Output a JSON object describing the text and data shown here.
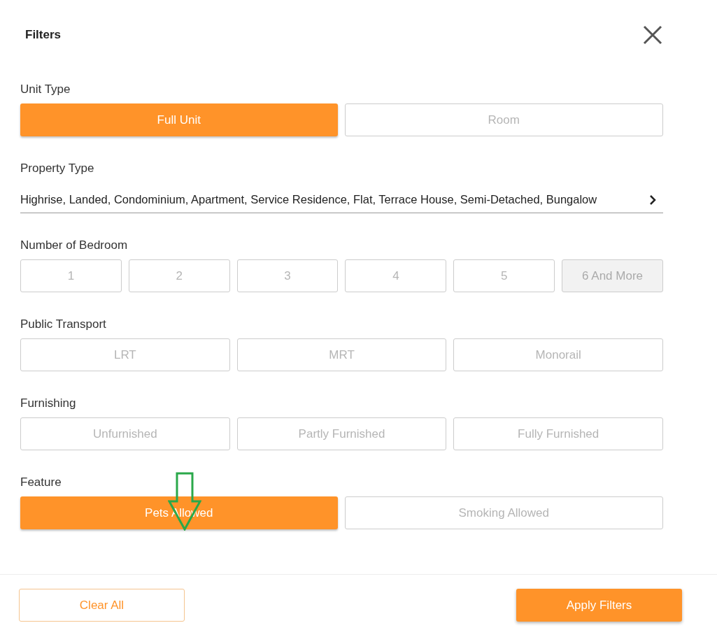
{
  "title": "Filters",
  "sections": [
    {
      "kind": "options",
      "label": "Unit Type",
      "options": [
        {
          "label": "Full Unit",
          "selected": true,
          "disabled": false
        },
        {
          "label": "Room",
          "selected": false,
          "disabled": false
        }
      ]
    },
    {
      "kind": "select",
      "label": "Property Type",
      "value": "Highrise, Landed, Condominium, Apartment, Service Residence, Flat, Terrace House, Semi-Detached, Bungalow"
    },
    {
      "kind": "options",
      "label": "Number of Bedroom",
      "options": [
        {
          "label": "1",
          "selected": false,
          "disabled": false
        },
        {
          "label": "2",
          "selected": false,
          "disabled": false
        },
        {
          "label": "3",
          "selected": false,
          "disabled": false
        },
        {
          "label": "4",
          "selected": false,
          "disabled": false
        },
        {
          "label": "5",
          "selected": false,
          "disabled": false
        },
        {
          "label": "6 And More",
          "selected": false,
          "disabled": true
        }
      ]
    },
    {
      "kind": "options",
      "label": "Public Transport",
      "options": [
        {
          "label": "LRT",
          "selected": false,
          "disabled": false
        },
        {
          "label": "MRT",
          "selected": false,
          "disabled": false
        },
        {
          "label": "Monorail",
          "selected": false,
          "disabled": false
        }
      ]
    },
    {
      "kind": "options",
      "label": "Furnishing",
      "options": [
        {
          "label": "Unfurnished",
          "selected": false,
          "disabled": false
        },
        {
          "label": "Partly Furnished",
          "selected": false,
          "disabled": false
        },
        {
          "label": "Fully Furnished",
          "selected": false,
          "disabled": false
        }
      ]
    },
    {
      "kind": "options",
      "label": "Feature",
      "options": [
        {
          "label": "Pets Allowed",
          "selected": true,
          "disabled": false
        },
        {
          "label": "Smoking Allowed",
          "selected": false,
          "disabled": false
        }
      ]
    }
  ],
  "footer": {
    "buttons": [
      {
        "label": "Clear All",
        "kind": "secondary"
      },
      {
        "label": "Apply Filters",
        "kind": "primary"
      }
    ]
  }
}
